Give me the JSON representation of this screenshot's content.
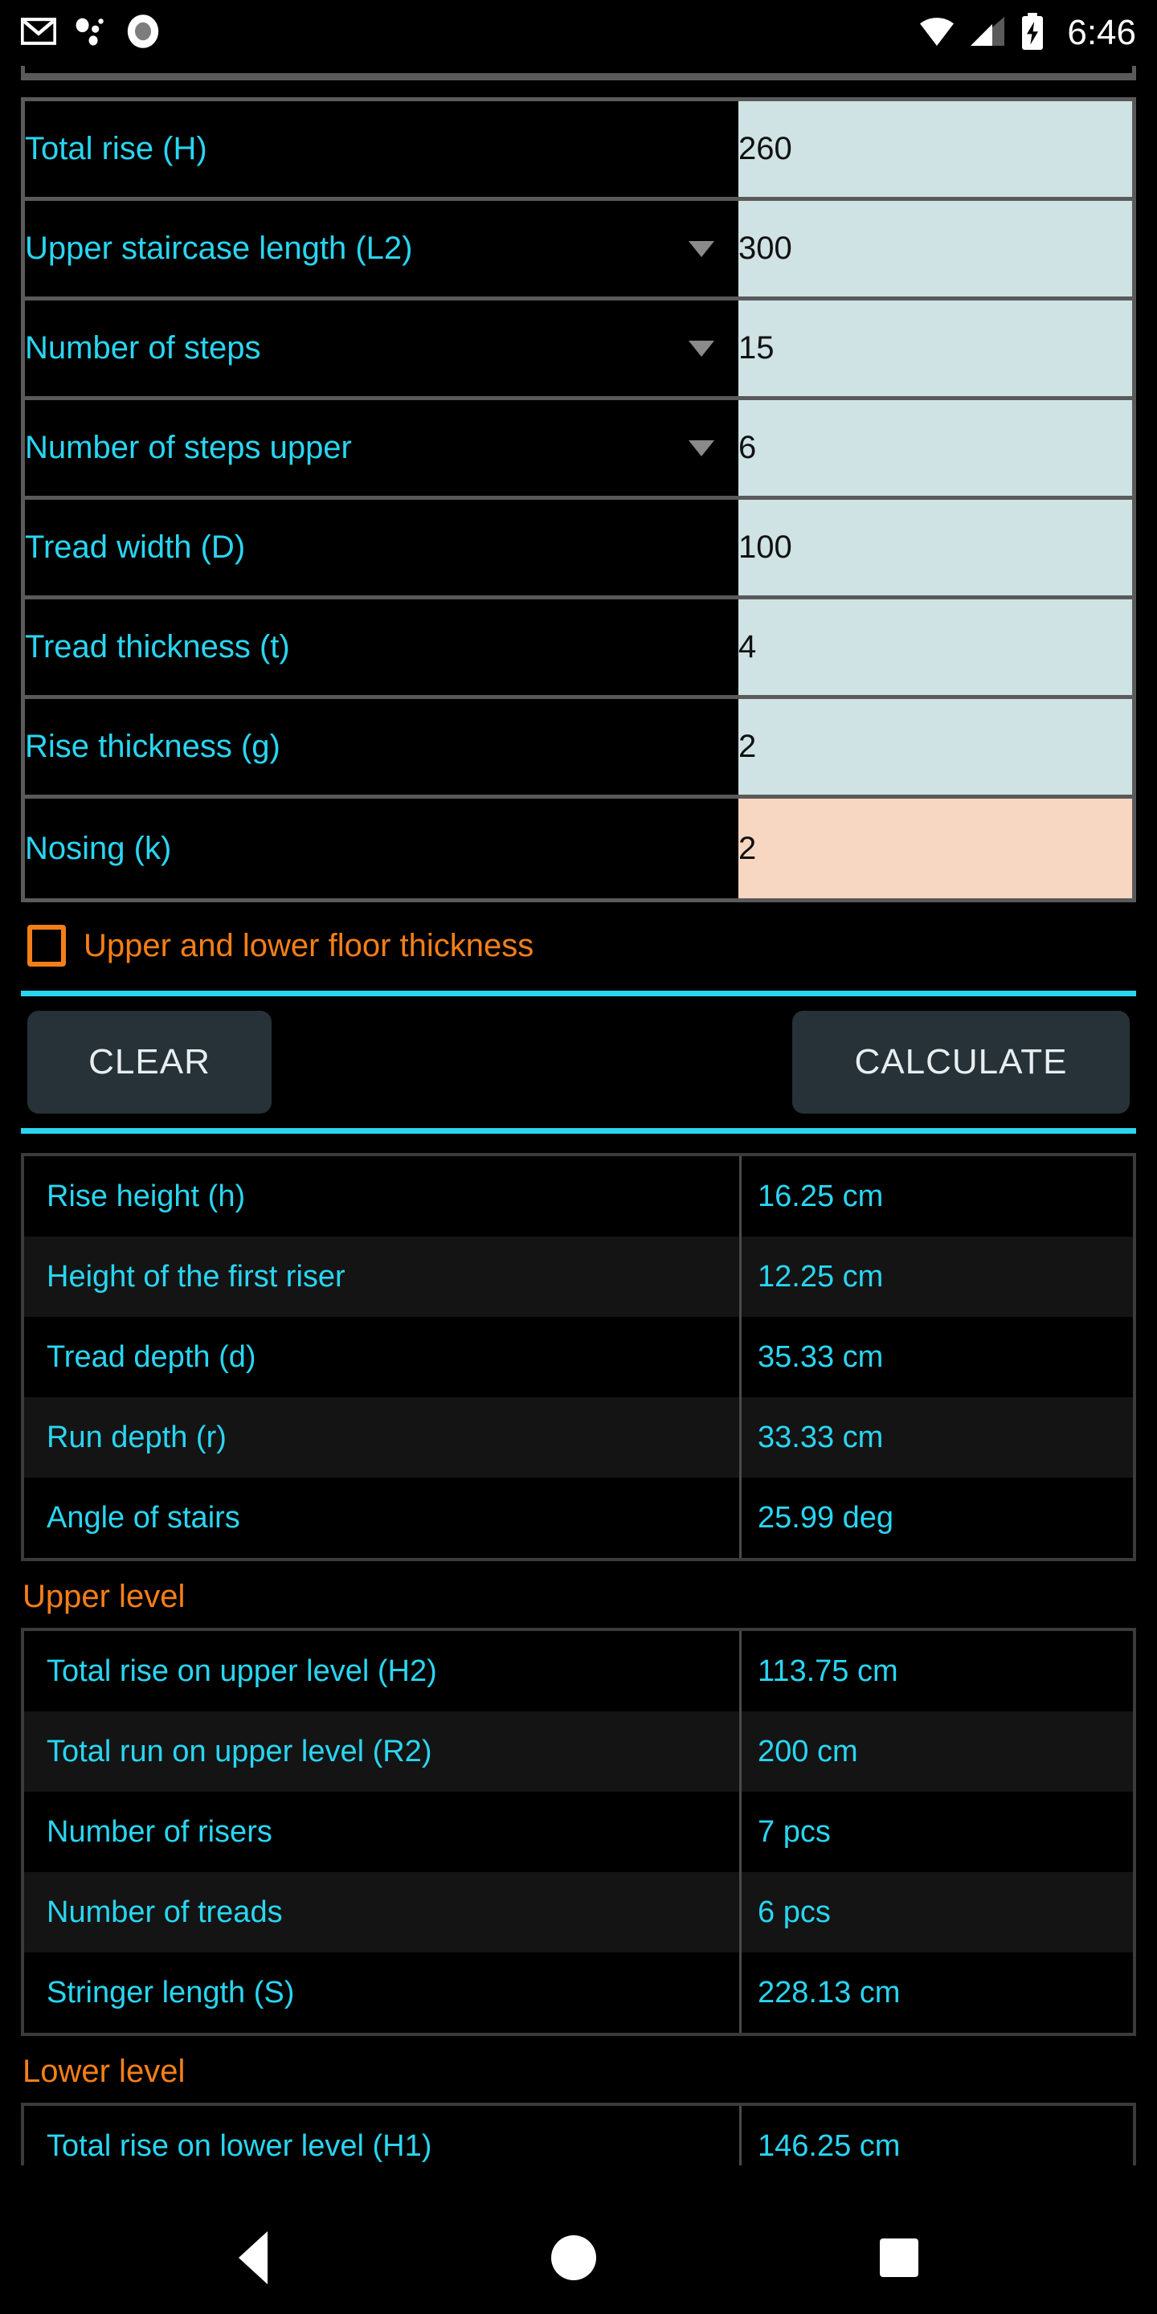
{
  "statusbar": {
    "time": "6:46",
    "icons": [
      "gmail-icon",
      "google-assistant-icon",
      "record-icon",
      "wifi-icon",
      "cellular-signal-icon",
      "battery-charging-icon"
    ]
  },
  "inputs": {
    "rows": [
      {
        "label": "Total rise (H)",
        "value": "260",
        "dropdown": false,
        "highlight": false
      },
      {
        "label": "Upper staircase length (L2)",
        "value": "300",
        "dropdown": true,
        "highlight": false
      },
      {
        "label": "Number of steps",
        "value": "15",
        "dropdown": true,
        "highlight": false
      },
      {
        "label": "Number of steps upper",
        "value": "6",
        "dropdown": true,
        "highlight": false
      },
      {
        "label": "Tread width (D)",
        "value": "100",
        "dropdown": false,
        "highlight": false
      },
      {
        "label": "Tread thickness (t)",
        "value": "4",
        "dropdown": false,
        "highlight": false
      },
      {
        "label": "Rise thickness (g)",
        "value": "2",
        "dropdown": false,
        "highlight": false
      },
      {
        "label": "Nosing (k)",
        "value": "2",
        "dropdown": false,
        "highlight": true
      }
    ]
  },
  "checkbox": {
    "label": "Upper and lower floor thickness",
    "checked": false
  },
  "buttons": {
    "clear": "CLEAR",
    "calculate": "CALCULATE"
  },
  "results": {
    "main": [
      {
        "label": "Rise height (h)",
        "value": "16.25 cm"
      },
      {
        "label": "Height of the first riser",
        "value": "12.25 cm"
      },
      {
        "label": "Tread depth (d)",
        "value": "35.33 cm"
      },
      {
        "label": "Run depth (r)",
        "value": "33.33 cm"
      },
      {
        "label": "Angle of stairs",
        "value": "25.99 deg"
      }
    ],
    "upper_title": "Upper level",
    "upper": [
      {
        "label": "Total rise on upper level (H2)",
        "value": "113.75 cm"
      },
      {
        "label": "Total run on upper level (R2)",
        "value": "200 cm"
      },
      {
        "label": "Number of risers",
        "value": "7 pcs"
      },
      {
        "label": "Number of treads",
        "value": "6 pcs"
      },
      {
        "label": "Stringer length (S)",
        "value": "228.13 cm"
      }
    ],
    "lower_title": "Lower level",
    "lower": [
      {
        "label": "Total rise on lower level (H1)",
        "value": "146.25 cm"
      }
    ]
  },
  "navbar": {
    "back": "back-button",
    "home": "home-button",
    "recents": "recents-button"
  },
  "colors": {
    "accent_cyan": "#29D6F2",
    "accent_orange": "#F57F17",
    "input_value_bg": "#CFE2E4",
    "input_value_highlight_bg": "#F7D6C2",
    "button_bg": "#263238",
    "background": "#000000"
  }
}
